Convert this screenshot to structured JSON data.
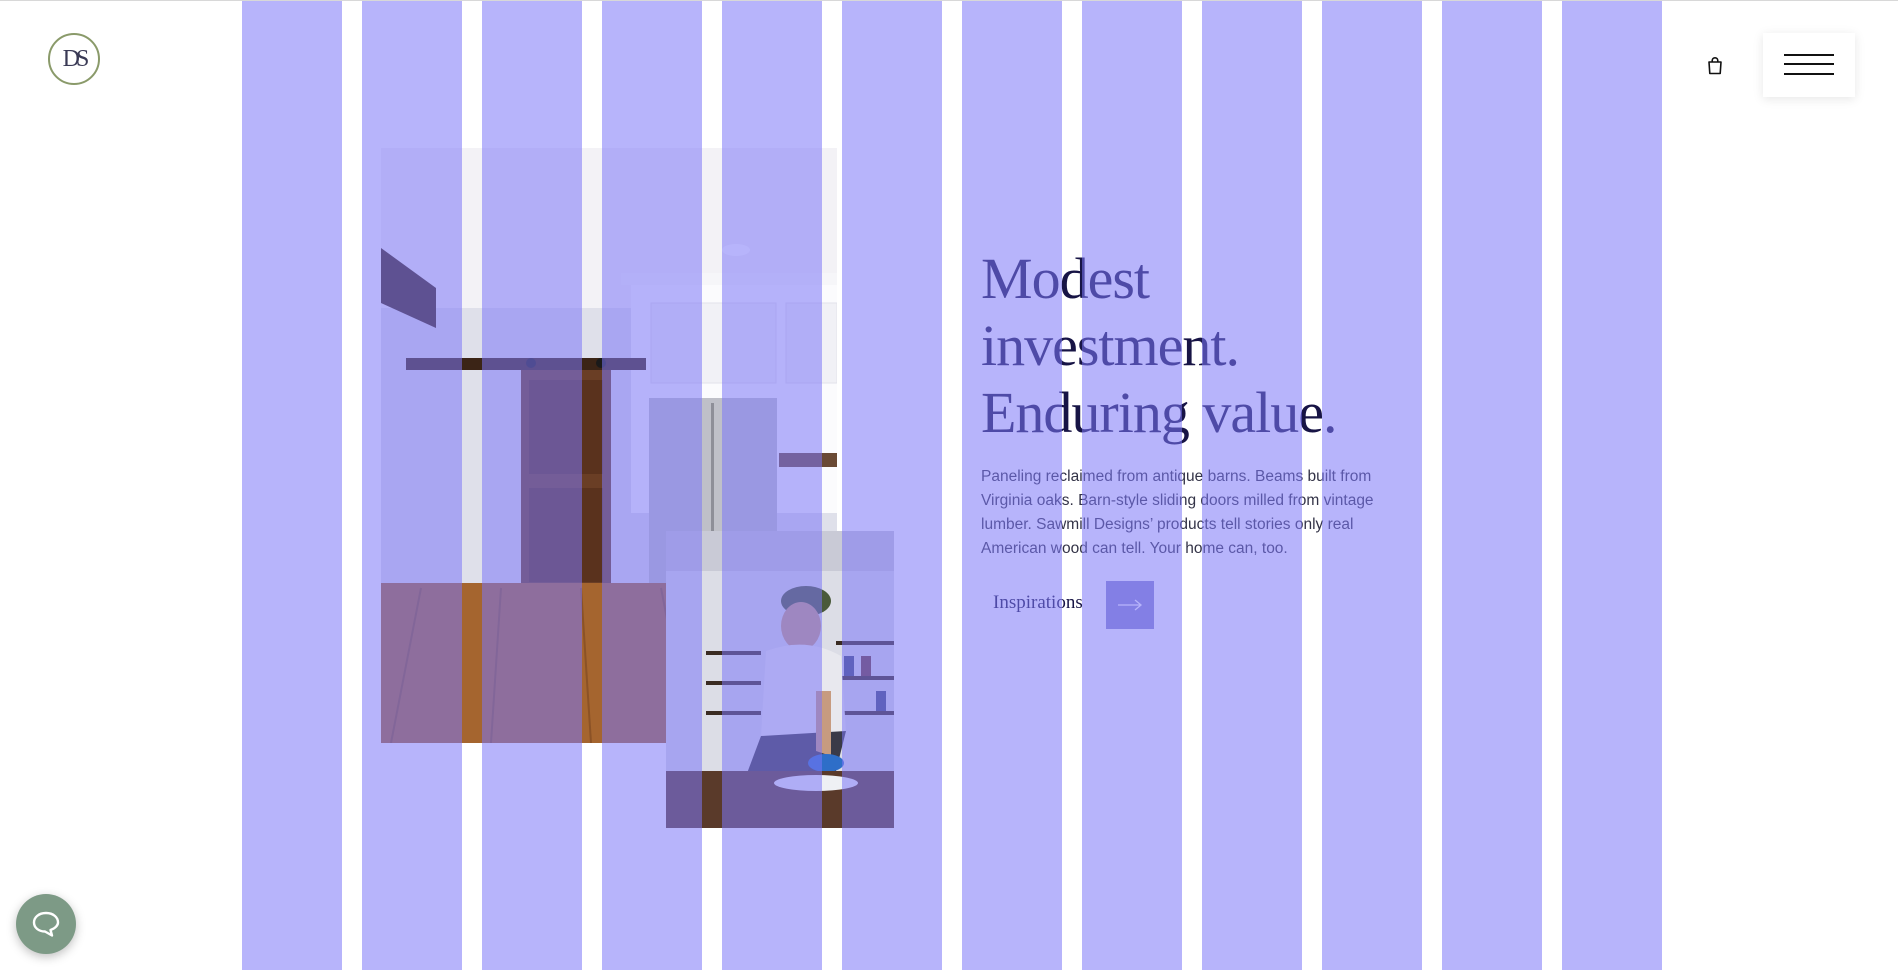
{
  "brand": {
    "logo_text": "DS",
    "colors": {
      "accent": "#8d89cf",
      "heading": "#171445",
      "logo_ring": "#8a9a6a",
      "chat_button": "#7d9a86",
      "grid_overlay": "#7c76f7"
    }
  },
  "header": {
    "cart_icon": "shopping-bag-icon",
    "menu_icon": "hamburger-menu-icon"
  },
  "hero": {
    "title_lines": [
      "Modest",
      "investment.",
      "Enduring value."
    ],
    "body": "Paneling reclaimed from antique barns. Beams built from Virginia oaks. Barn-style sliding doors milled from vintage lumber. Sawmill Designs’ products tell stories only real American wood can tell. Your home can, too.",
    "cta_label": "Inspirations",
    "cta_icon": "arrow-right-icon"
  },
  "images": {
    "primary": "kitchen-with-barn-door-photo",
    "secondary": "craftsman-wiping-table-photo"
  },
  "chat": {
    "icon": "chat-bubble-icon"
  }
}
